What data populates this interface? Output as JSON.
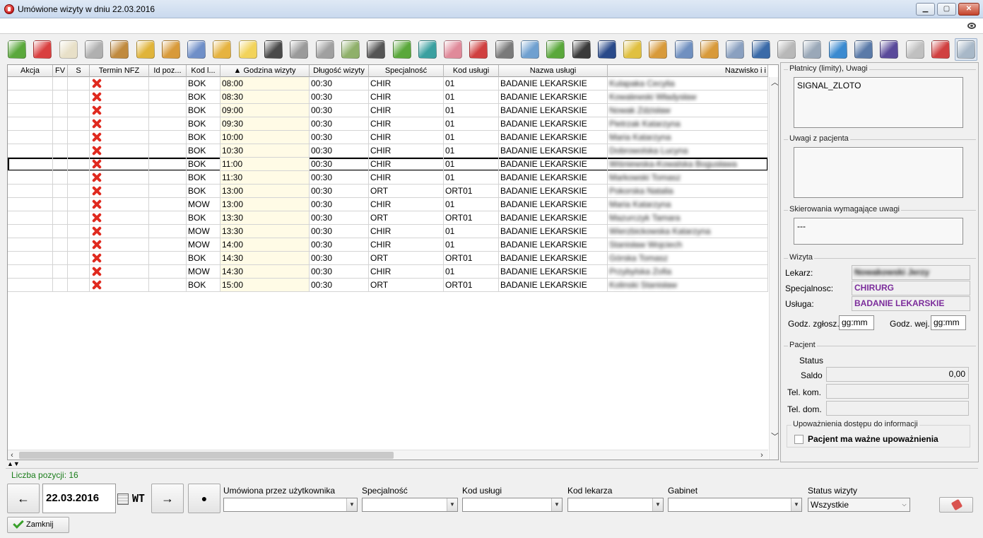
{
  "window": {
    "title": "Umówione wizyty w dniu 22.03.2016",
    "minimize": "▁",
    "maximize": "▢",
    "close": "✕"
  },
  "toolbar": {
    "icons": [
      {
        "name": "add-icon",
        "color": "#5aa83b"
      },
      {
        "name": "delete-icon",
        "color": "#d94040"
      },
      {
        "name": "edit-icon",
        "color": "#e8e0c8"
      },
      {
        "name": "calculator-icon",
        "color": "#b0b0b0"
      },
      {
        "name": "user-add-icon",
        "color": "#c08a3e"
      },
      {
        "name": "folder-user-icon",
        "color": "#e0b43a"
      },
      {
        "name": "user-money-icon",
        "color": "#d89a3a"
      },
      {
        "name": "calendar-icon",
        "color": "#6f8fc8"
      },
      {
        "name": "user-edit-icon",
        "color": "#e6b340"
      },
      {
        "name": "smiley-icon",
        "color": "#f2d35a"
      },
      {
        "name": "monitor-user-icon",
        "color": "#4a4a4a"
      },
      {
        "name": "document-icon",
        "color": "#9a9a9a"
      },
      {
        "name": "clip-icon",
        "color": "#a0a0a0"
      },
      {
        "name": "attach-add-icon",
        "color": "#8fb06a"
      },
      {
        "name": "barcode-icon",
        "color": "#555555"
      },
      {
        "name": "check-card-icon",
        "color": "#5aa83b"
      },
      {
        "name": "stethoscope-icon",
        "color": "#3aa0a0"
      },
      {
        "name": "hands-icon",
        "color": "#e08a9a"
      },
      {
        "name": "test-tube-icon",
        "color": "#d04040"
      },
      {
        "name": "syringe-icon",
        "color": "#7a7a7a"
      },
      {
        "name": "window-add-icon",
        "color": "#6fa0d0"
      },
      {
        "name": "doc-add-icon",
        "color": "#5aa83b"
      },
      {
        "name": "cabinet-icon",
        "color": "#3a3a3a"
      },
      {
        "name": "pen-circle-icon",
        "color": "#2a4a8a"
      },
      {
        "name": "chart-edit-icon",
        "color": "#e0c040"
      },
      {
        "name": "user-check-icon",
        "color": "#d89a3a"
      },
      {
        "name": "calendar-edit-icon",
        "color": "#7090c0"
      },
      {
        "name": "user-pen-icon",
        "color": "#d89a3a"
      },
      {
        "name": "door-exit-icon",
        "color": "#8aa0c0"
      },
      {
        "name": "ecg-monitor-icon",
        "color": "#3a6aa8"
      },
      {
        "name": "printer-icon",
        "color": "#b8b8b8"
      },
      {
        "name": "gears-icon",
        "color": "#9aa8b8"
      },
      {
        "name": "refresh-icon",
        "color": "#3a8ad0"
      },
      {
        "name": "width-icon",
        "color": "#5a7aa8"
      },
      {
        "name": "sum-icon",
        "color": "#5a4a9a"
      },
      {
        "name": "print-edit-icon",
        "color": "#c0c0c0"
      },
      {
        "name": "list-mark-icon",
        "color": "#d04040"
      },
      {
        "name": "preview-icon",
        "color": "#a8b8c8"
      }
    ]
  },
  "grid": {
    "columns": [
      "Akcja",
      "FV",
      "S",
      "Termin NFZ",
      "Id poz...",
      "Kod l...",
      "▲ Godzina wizyty",
      "Długość wizyty",
      "Specjalność",
      "Kod usługi",
      "Nazwa usługi",
      "Nazwisko i i"
    ],
    "rows": [
      {
        "kod": "BOK",
        "godz": "08:00",
        "dl": "00:30",
        "spec": "CHIR",
        "usl": "01",
        "nazwa": "BADANIE LEKARSKIE",
        "pacjent": "Kulapaka Cecylia"
      },
      {
        "kod": "BOK",
        "godz": "08:30",
        "dl": "00:30",
        "spec": "CHIR",
        "usl": "01",
        "nazwa": "BADANIE LEKARSKIE",
        "pacjent": "Kowalewski Władysław"
      },
      {
        "kod": "BOK",
        "godz": "09:00",
        "dl": "00:30",
        "spec": "CHIR",
        "usl": "01",
        "nazwa": "BADANIE LEKARSKIE",
        "pacjent": "Nowak Zdzisław"
      },
      {
        "kod": "BOK",
        "godz": "09:30",
        "dl": "00:30",
        "spec": "CHIR",
        "usl": "01",
        "nazwa": "BADANIE LEKARSKIE",
        "pacjent": "Pietrzak Katarzyna"
      },
      {
        "kod": "BOK",
        "godz": "10:00",
        "dl": "00:30",
        "spec": "CHIR",
        "usl": "01",
        "nazwa": "BADANIE LEKARSKIE",
        "pacjent": "Maria Katarzyna"
      },
      {
        "kod": "BOK",
        "godz": "10:30",
        "dl": "00:30",
        "spec": "CHIR",
        "usl": "01",
        "nazwa": "BADANIE LEKARSKIE",
        "pacjent": "Dobrowolska Lucyna"
      },
      {
        "kod": "BOK",
        "godz": "11:00",
        "dl": "00:30",
        "spec": "CHIR",
        "usl": "01",
        "nazwa": "BADANIE LEKARSKIE",
        "pacjent": "Wiśniewska-Kowalska Bogusława"
      },
      {
        "kod": "BOK",
        "godz": "11:30",
        "dl": "00:30",
        "spec": "CHIR",
        "usl": "01",
        "nazwa": "BADANIE LEKARSKIE",
        "pacjent": "Markowski Tomasz"
      },
      {
        "kod": "BOK",
        "godz": "13:00",
        "dl": "00:30",
        "spec": "ORT",
        "usl": "ORT01",
        "nazwa": "BADANIE LEKARSKIE",
        "pacjent": "Pokorska Natalia"
      },
      {
        "kod": "MOW",
        "godz": "13:00",
        "dl": "00:30",
        "spec": "CHIR",
        "usl": "01",
        "nazwa": "BADANIE LEKARSKIE",
        "pacjent": "Maria Katarzyna"
      },
      {
        "kod": "BOK",
        "godz": "13:30",
        "dl": "00:30",
        "spec": "ORT",
        "usl": "ORT01",
        "nazwa": "BADANIE LEKARSKIE",
        "pacjent": "Mazurczyk Tamara"
      },
      {
        "kod": "MOW",
        "godz": "13:30",
        "dl": "00:30",
        "spec": "CHIR",
        "usl": "01",
        "nazwa": "BADANIE LEKARSKIE",
        "pacjent": "Wierzbickowska Katarzyna"
      },
      {
        "kod": "MOW",
        "godz": "14:00",
        "dl": "00:30",
        "spec": "CHIR",
        "usl": "01",
        "nazwa": "BADANIE LEKARSKIE",
        "pacjent": "Stanisław Wojciech"
      },
      {
        "kod": "BOK",
        "godz": "14:30",
        "dl": "00:30",
        "spec": "ORT",
        "usl": "ORT01",
        "nazwa": "BADANIE LEKARSKIE",
        "pacjent": "Górska Tomasz"
      },
      {
        "kod": "MOW",
        "godz": "14:30",
        "dl": "00:30",
        "spec": "CHIR",
        "usl": "01",
        "nazwa": "BADANIE LEKARSKIE",
        "pacjent": "Przybylska Zofia"
      },
      {
        "kod": "BOK",
        "godz": "15:00",
        "dl": "00:30",
        "spec": "ORT",
        "usl": "ORT01",
        "nazwa": "BADANIE LEKARSKIE",
        "pacjent": "Kolinski Stanisław"
      }
    ],
    "selected_row": 6
  },
  "panel": {
    "platnicy_label": "Płatnicy (limity), Uwagi",
    "platnicy_value": "SIGNAL_ZLOTO",
    "uwagi_label": "Uwagi z pacjenta",
    "skierowania_label": "Skierowania wymagające uwagi",
    "skierowania_value": "---",
    "wizyta_label": "Wizyta",
    "lekarz_label": "Lekarz:",
    "lekarz_value": "Nowakowski Jerzy",
    "specjalnosc_label": "Specjalnosc:",
    "specjalnosc_value": "CHIRURG",
    "usluga_label": "Usługa:",
    "usluga_value": "BADANIE LEKARSKIE",
    "godz_zgl_label": "Godz. zgłosz.",
    "godz_zgl_value": "gg:mm",
    "godz_wej_label": "Godz. wej.",
    "godz_wej_value": "gg:mm",
    "pacjent_label": "Pacjent",
    "status_label": "Status",
    "saldo_label": "Saldo",
    "saldo_value": "0,00",
    "tel_kom_label": "Tel. kom.",
    "tel_dom_label": "Tel. dom.",
    "upowaznienia_label": "Upoważnienia dostępu do informacji",
    "upowaznienia_check": "Pacjent ma ważne upoważnienia"
  },
  "bottom": {
    "count_label": "Liczba pozycji: 16",
    "prev": "←",
    "next": "→",
    "today": "●",
    "date": "22.03.2016",
    "dow": "WT",
    "umowiona_label": "Umówiona przez użytkownika",
    "specjalnosc_label": "Specjalność",
    "kod_uslugi_label": "Kod usługi",
    "kod_lekarza_label": "Kod lekarza",
    "gabinet_label": "Gabinet",
    "status_label": "Status wizyty",
    "status_value": "Wszystkie",
    "close_label": "Zamknij"
  }
}
